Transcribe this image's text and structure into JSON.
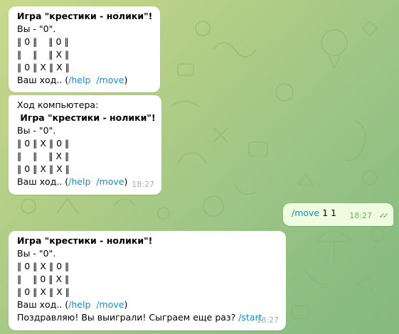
{
  "messages": [
    {
      "lines": [
        "Игра \"крестики - нолики\"!",
        "Вы - \"0\".",
        "‖ 0 ‖    ‖ 0 ‖",
        "‖    ‖    ‖ X ‖",
        "‖ 0 ‖ X ‖ X ‖"
      ],
      "prompt_prefix": "Ваш ход.. (",
      "cmd_help": "/help",
      "cmd_move": "/move",
      "prompt_suffix": ")"
    },
    {
      "lines": [
        "Ход компьютера:",
        " Игра \"крестики - нолики\"!",
        "Вы - \"0\".",
        "‖ 0 ‖ X ‖ 0 ‖",
        "‖    ‖    ‖ X ‖",
        "‖ 0 ‖ X ‖ X ‖"
      ],
      "prompt_prefix": "Ваш ход.. (",
      "cmd_help": "/help",
      "cmd_move": "/move",
      "prompt_suffix": ")",
      "time": "18:27"
    },
    {
      "cmd": "/move",
      "text": " 1 1",
      "time": "18:27"
    },
    {
      "lines": [
        "Игра \"крестики - нолики\"!",
        "Вы - \"0\".",
        "‖ 0 ‖ X ‖ 0 ‖",
        "‖    ‖ 0 ‖ X ‖",
        "‖ 0 ‖ X ‖ X ‖"
      ],
      "prompt_prefix": "Ваш ход.. (",
      "cmd_help": "/help",
      "cmd_move": "/move",
      "prompt_suffix": ")",
      "win_text": "Поздравляю! Вы выиграли! Сыграем еще раз? ",
      "cmd_start": "/start",
      "time": "18:27"
    }
  ]
}
